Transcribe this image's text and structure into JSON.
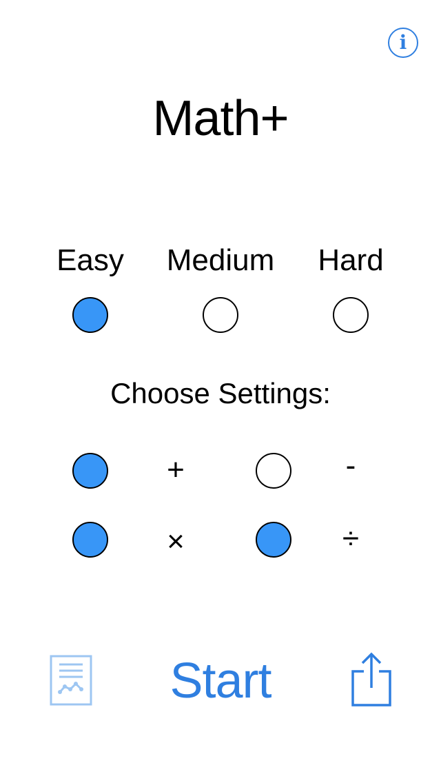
{
  "header": {
    "info_glyph": "i",
    "title": "Math+"
  },
  "difficulty": {
    "options": [
      {
        "label": "Easy",
        "selected": true
      },
      {
        "label": "Medium",
        "selected": false
      },
      {
        "label": "Hard",
        "selected": false
      }
    ]
  },
  "settings": {
    "heading": "Choose Settings:",
    "operations": [
      {
        "symbol": "+",
        "enabled": true
      },
      {
        "symbol": "-",
        "enabled": false
      },
      {
        "symbol": "×",
        "enabled": true
      },
      {
        "symbol": "÷",
        "enabled": true
      }
    ]
  },
  "footer": {
    "start_label": "Start",
    "stats_icon": "stats-document-icon",
    "share_icon": "share-icon"
  },
  "colors": {
    "accent": "#2f7fe0",
    "radio_on": "#3896f7",
    "stats_icon": "#9dc6f2"
  }
}
